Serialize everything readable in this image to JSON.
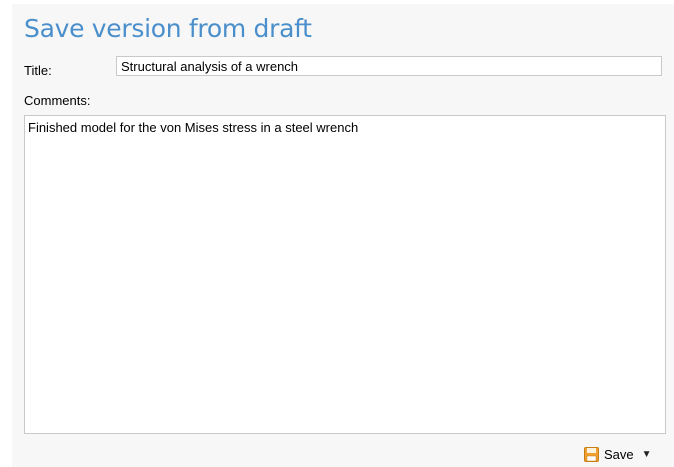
{
  "dialog": {
    "heading": "Save version from draft",
    "title_label": "Title:",
    "title_value": "Structural analysis of a wrench",
    "comments_label": "Comments:",
    "comments_value": "Finished model for the von Mises stress in a steel wrench",
    "save_label": "Save",
    "icons": {
      "save": "floppy-disk-icon",
      "dropdown": "chevron-down-icon"
    },
    "colors": {
      "heading": "#4a8fcc",
      "background": "#f7f7f7",
      "save_icon": "#f0a030"
    }
  }
}
